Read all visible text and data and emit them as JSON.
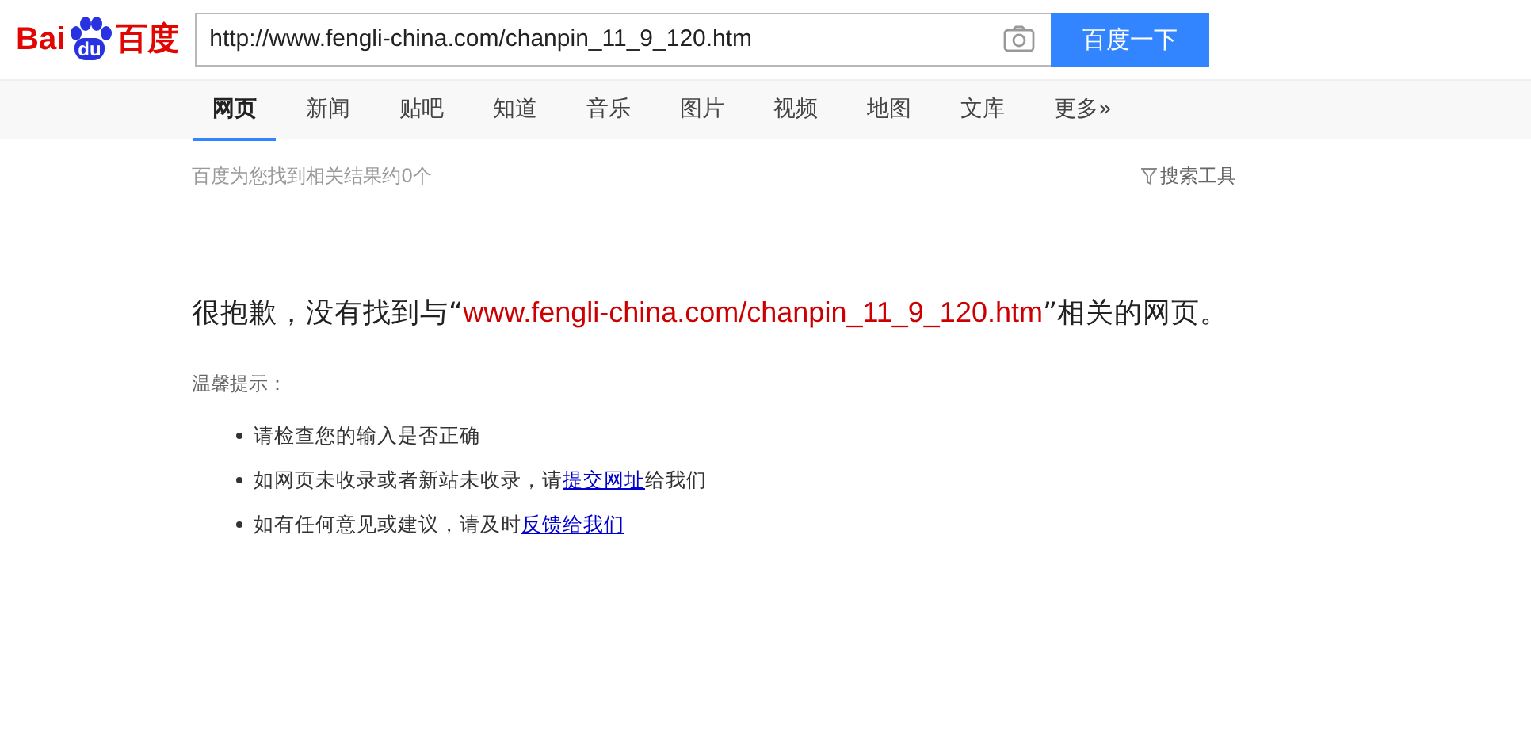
{
  "logo": {
    "left": "Bai",
    "paw": "du",
    "right": "百度"
  },
  "search": {
    "value": "http://www.fengli-china.com/chanpin_11_9_120.htm",
    "button": "百度一下"
  },
  "tabs": [
    {
      "label": "网页",
      "selected": true
    },
    {
      "label": "新闻",
      "selected": false
    },
    {
      "label": "贴吧",
      "selected": false
    },
    {
      "label": "知道",
      "selected": false
    },
    {
      "label": "音乐",
      "selected": false
    },
    {
      "label": "图片",
      "selected": false
    },
    {
      "label": "视频",
      "selected": false
    },
    {
      "label": "地图",
      "selected": false
    },
    {
      "label": "文库",
      "selected": false
    },
    {
      "label": "更多»",
      "selected": false
    }
  ],
  "result_count": "百度为您找到相关结果约0个",
  "search_tools": "搜索工具",
  "message": {
    "prefix": "很抱歉，没有找到与“",
    "query": "www.fengli-china.com/chanpin_11_9_120.htm",
    "suffix": "”相关的网页。"
  },
  "tips_title": "温馨提示：",
  "tips": [
    {
      "parts": [
        {
          "kind": "text",
          "text": "请检查您的输入是否正确"
        }
      ]
    },
    {
      "parts": [
        {
          "kind": "text",
          "text": "如网页未收录或者新站未收录，请"
        },
        {
          "kind": "link",
          "text": "提交网址"
        },
        {
          "kind": "text",
          "text": "给我们"
        }
      ]
    },
    {
      "parts": [
        {
          "kind": "text",
          "text": "如有任何意见或建议，请及时"
        },
        {
          "kind": "link",
          "text": "反馈给我们"
        }
      ]
    }
  ]
}
